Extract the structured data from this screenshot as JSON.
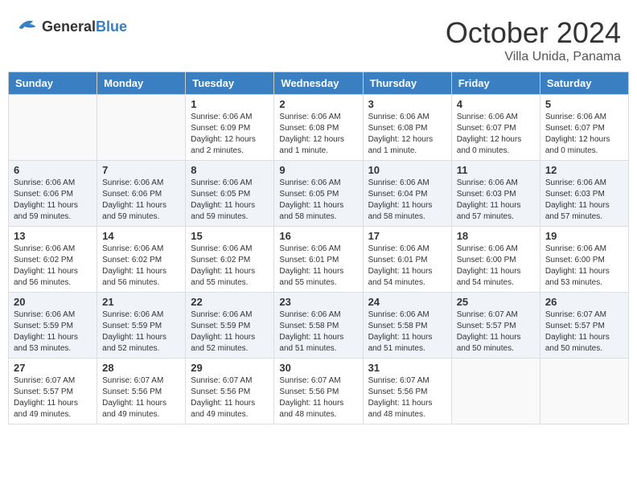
{
  "header": {
    "logo_general": "General",
    "logo_blue": "Blue",
    "month": "October 2024",
    "location": "Villa Unida, Panama"
  },
  "weekdays": [
    "Sunday",
    "Monday",
    "Tuesday",
    "Wednesday",
    "Thursday",
    "Friday",
    "Saturday"
  ],
  "weeks": [
    [
      {
        "day": "",
        "empty": true
      },
      {
        "day": "",
        "empty": true
      },
      {
        "day": "1",
        "sunrise": "6:06 AM",
        "sunset": "6:09 PM",
        "daylight": "12 hours and 2 minutes."
      },
      {
        "day": "2",
        "sunrise": "6:06 AM",
        "sunset": "6:08 PM",
        "daylight": "12 hours and 1 minute."
      },
      {
        "day": "3",
        "sunrise": "6:06 AM",
        "sunset": "6:08 PM",
        "daylight": "12 hours and 1 minute."
      },
      {
        "day": "4",
        "sunrise": "6:06 AM",
        "sunset": "6:07 PM",
        "daylight": "12 hours and 0 minutes."
      },
      {
        "day": "5",
        "sunrise": "6:06 AM",
        "sunset": "6:07 PM",
        "daylight": "12 hours and 0 minutes."
      }
    ],
    [
      {
        "day": "6",
        "sunrise": "6:06 AM",
        "sunset": "6:06 PM",
        "daylight": "11 hours and 59 minutes."
      },
      {
        "day": "7",
        "sunrise": "6:06 AM",
        "sunset": "6:06 PM",
        "daylight": "11 hours and 59 minutes."
      },
      {
        "day": "8",
        "sunrise": "6:06 AM",
        "sunset": "6:05 PM",
        "daylight": "11 hours and 59 minutes."
      },
      {
        "day": "9",
        "sunrise": "6:06 AM",
        "sunset": "6:05 PM",
        "daylight": "11 hours and 58 minutes."
      },
      {
        "day": "10",
        "sunrise": "6:06 AM",
        "sunset": "6:04 PM",
        "daylight": "11 hours and 58 minutes."
      },
      {
        "day": "11",
        "sunrise": "6:06 AM",
        "sunset": "6:03 PM",
        "daylight": "11 hours and 57 minutes."
      },
      {
        "day": "12",
        "sunrise": "6:06 AM",
        "sunset": "6:03 PM",
        "daylight": "11 hours and 57 minutes."
      }
    ],
    [
      {
        "day": "13",
        "sunrise": "6:06 AM",
        "sunset": "6:02 PM",
        "daylight": "11 hours and 56 minutes."
      },
      {
        "day": "14",
        "sunrise": "6:06 AM",
        "sunset": "6:02 PM",
        "daylight": "11 hours and 56 minutes."
      },
      {
        "day": "15",
        "sunrise": "6:06 AM",
        "sunset": "6:02 PM",
        "daylight": "11 hours and 55 minutes."
      },
      {
        "day": "16",
        "sunrise": "6:06 AM",
        "sunset": "6:01 PM",
        "daylight": "11 hours and 55 minutes."
      },
      {
        "day": "17",
        "sunrise": "6:06 AM",
        "sunset": "6:01 PM",
        "daylight": "11 hours and 54 minutes."
      },
      {
        "day": "18",
        "sunrise": "6:06 AM",
        "sunset": "6:00 PM",
        "daylight": "11 hours and 54 minutes."
      },
      {
        "day": "19",
        "sunrise": "6:06 AM",
        "sunset": "6:00 PM",
        "daylight": "11 hours and 53 minutes."
      }
    ],
    [
      {
        "day": "20",
        "sunrise": "6:06 AM",
        "sunset": "5:59 PM",
        "daylight": "11 hours and 53 minutes."
      },
      {
        "day": "21",
        "sunrise": "6:06 AM",
        "sunset": "5:59 PM",
        "daylight": "11 hours and 52 minutes."
      },
      {
        "day": "22",
        "sunrise": "6:06 AM",
        "sunset": "5:59 PM",
        "daylight": "11 hours and 52 minutes."
      },
      {
        "day": "23",
        "sunrise": "6:06 AM",
        "sunset": "5:58 PM",
        "daylight": "11 hours and 51 minutes."
      },
      {
        "day": "24",
        "sunrise": "6:06 AM",
        "sunset": "5:58 PM",
        "daylight": "11 hours and 51 minutes."
      },
      {
        "day": "25",
        "sunrise": "6:07 AM",
        "sunset": "5:57 PM",
        "daylight": "11 hours and 50 minutes."
      },
      {
        "day": "26",
        "sunrise": "6:07 AM",
        "sunset": "5:57 PM",
        "daylight": "11 hours and 50 minutes."
      }
    ],
    [
      {
        "day": "27",
        "sunrise": "6:07 AM",
        "sunset": "5:57 PM",
        "daylight": "11 hours and 49 minutes."
      },
      {
        "day": "28",
        "sunrise": "6:07 AM",
        "sunset": "5:56 PM",
        "daylight": "11 hours and 49 minutes."
      },
      {
        "day": "29",
        "sunrise": "6:07 AM",
        "sunset": "5:56 PM",
        "daylight": "11 hours and 49 minutes."
      },
      {
        "day": "30",
        "sunrise": "6:07 AM",
        "sunset": "5:56 PM",
        "daylight": "11 hours and 48 minutes."
      },
      {
        "day": "31",
        "sunrise": "6:07 AM",
        "sunset": "5:56 PM",
        "daylight": "11 hours and 48 minutes."
      },
      {
        "day": "",
        "empty": true
      },
      {
        "day": "",
        "empty": true
      }
    ]
  ]
}
